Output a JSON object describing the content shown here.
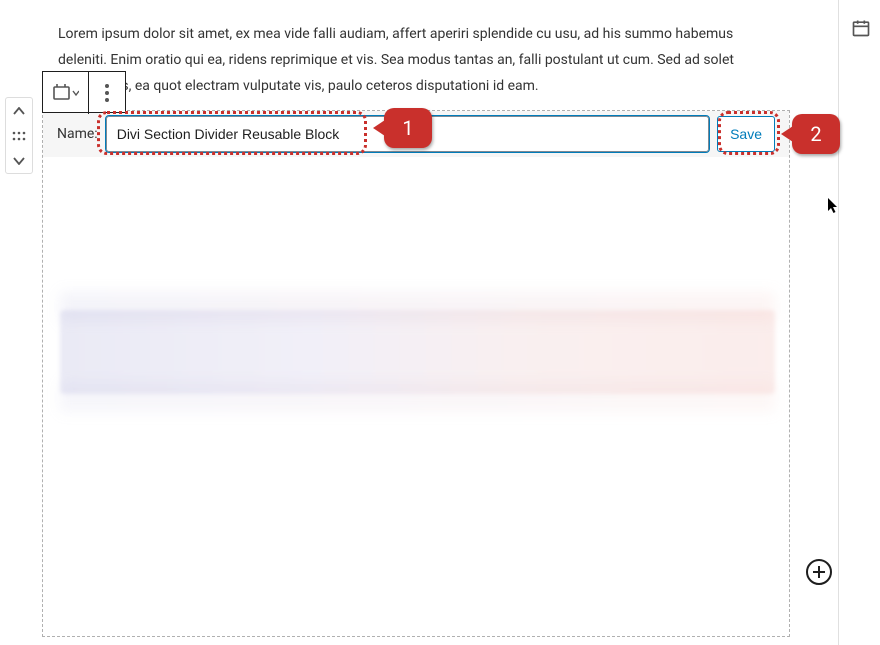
{
  "lorem": "Lorem ipsum dolor sit amet, ex mea vide falli audiam, affert aperiri splendide cu usu, ad his summo habemus deleniti. Enim oratio qui ea, ridens reprimique et vis. Sea modus tantas an, falli postulant ut cum. Sed ad solet moderatius, ea quot electram vulputate vis, paulo ceteros disputationi id eam.",
  "toolbar": {
    "name_label": "Name:",
    "name_value": "Divi Section Divider Reusable Block",
    "save_label": "Save"
  },
  "callouts": {
    "one": "1",
    "two": "2"
  }
}
